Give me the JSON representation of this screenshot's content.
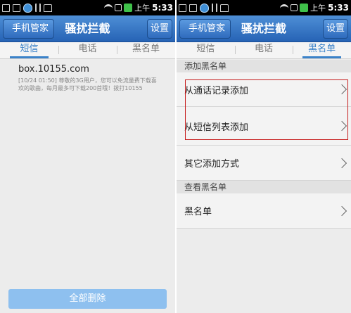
{
  "status_bar": {
    "clock_label": "上午",
    "time": "5:33"
  },
  "left_screen": {
    "header": {
      "back_label": "手机管家",
      "title": "骚扰拦截",
      "settings_label": "设置"
    },
    "tabs": [
      {
        "label": "短信",
        "active": true
      },
      {
        "label": "电话",
        "active": false
      },
      {
        "label": "黑名单",
        "active": false
      }
    ],
    "message": {
      "sender": "box.10155.com",
      "body": "[10/24 01:50] 尊敬的3G用户，您可以免流量费下载喜欢的歌曲，每月最多可下载200首哦！拨打10155"
    },
    "delete_all_label": "全部删除"
  },
  "right_screen": {
    "header": {
      "back_label": "手机管家",
      "title": "骚扰拦截",
      "settings_label": "设置"
    },
    "tabs": [
      {
        "label": "短信",
        "active": false
      },
      {
        "label": "电话",
        "active": false
      },
      {
        "label": "黑名单",
        "active": true
      }
    ],
    "add_section_title": "添加黑名单",
    "add_items": [
      {
        "label": "从通话记录添加"
      },
      {
        "label": "从短信列表添加"
      },
      {
        "label": "其它添加方式"
      }
    ],
    "view_section_title": "查看黑名单",
    "view_items": [
      {
        "label": "黑名单"
      }
    ]
  },
  "colors": {
    "accent": "#3b82c9",
    "title_bar": "#2f6bbd",
    "highlight_border": "#c61d1d"
  }
}
